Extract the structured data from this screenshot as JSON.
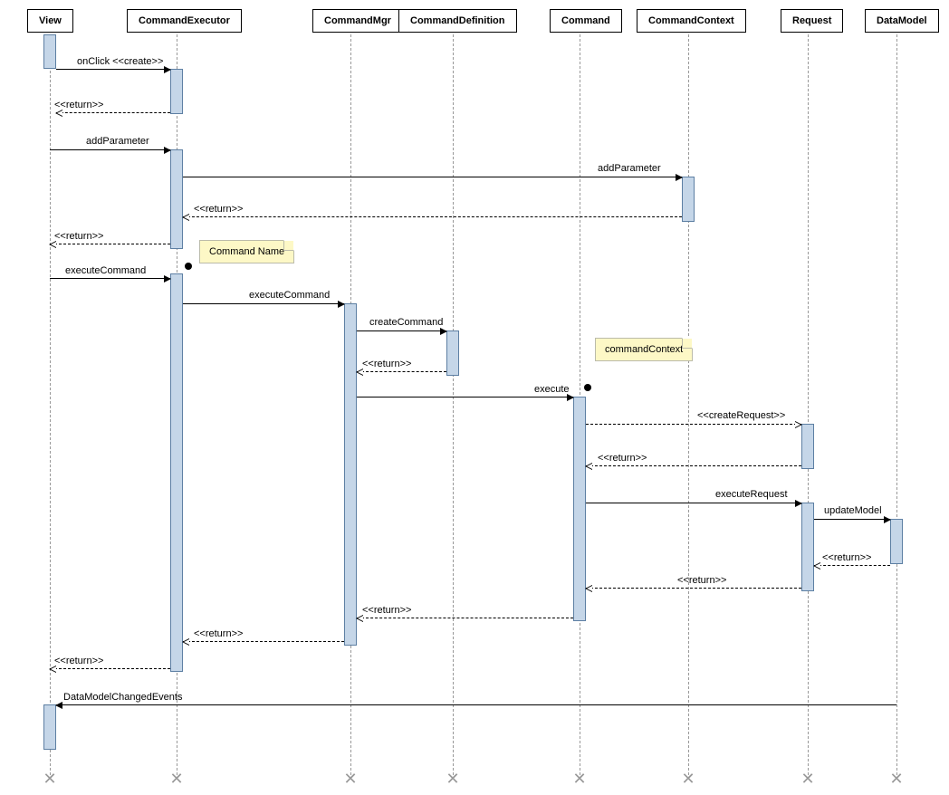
{
  "participants": {
    "view": "View",
    "commandExecutor": "CommandExecutor",
    "commandMgr": "CommandMgr",
    "commandDefinition": "CommandDefinition",
    "command": "Command",
    "commandContext": "CommandContext",
    "request": "Request",
    "dataModel": "DataModel"
  },
  "messages": {
    "onClick": "onClick <<create>>",
    "return": "<<return>>",
    "addParameter1": "addParameter",
    "addParameter2": "addParameter",
    "executeCommand1": "executeCommand",
    "executeCommand2": "executeCommand",
    "createCommand": "createCommand",
    "execute": "execute",
    "createRequest": "<<createRequest>>",
    "executeRequest": "executeRequest",
    "updateModel": "updateModel",
    "dataModelChangedEvents": "DataModelChangedEvents"
  },
  "notes": {
    "commandName": "Command Name",
    "commandContext": "commandContext"
  },
  "lifelines_x": {
    "view": 55,
    "commandExecutor": 195,
    "commandMgr": 387,
    "commandDefinition": 500,
    "command": 640,
    "commandContext": 760,
    "request": 892,
    "dataModel": 990
  }
}
